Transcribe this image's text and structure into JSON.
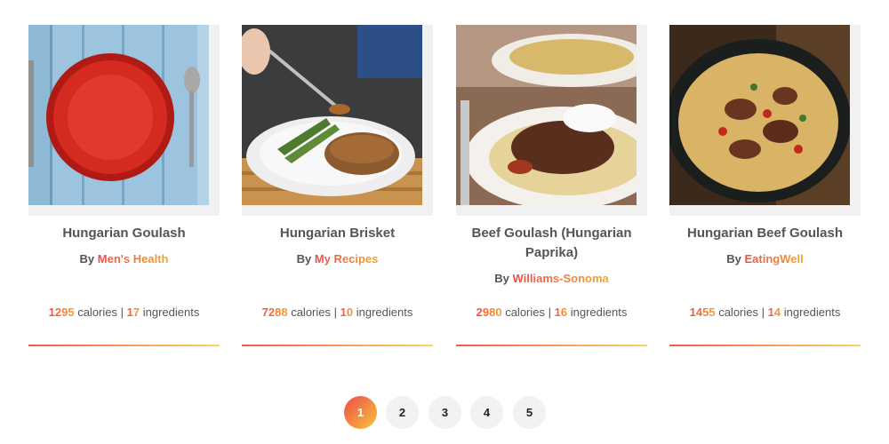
{
  "recipes": [
    {
      "title": "Hungarian Goulash",
      "by": "By",
      "source": "Men's Health",
      "calories": "1295",
      "calories_label": "calories",
      "sep": "|",
      "ingredients": "17",
      "ingredients_label": "ingredients"
    },
    {
      "title": "Hungarian Brisket",
      "by": "By",
      "source": "My Recipes",
      "calories": "7288",
      "calories_label": "calories",
      "sep": "|",
      "ingredients": "10",
      "ingredients_label": "ingredients"
    },
    {
      "title": "Beef Goulash (Hungarian Paprika)",
      "by": "By",
      "source": "Williams-Sonoma",
      "calories": "2980",
      "calories_label": "calories",
      "sep": "|",
      "ingredients": "16",
      "ingredients_label": "ingredients"
    },
    {
      "title": "Hungarian Beef Goulash",
      "by": "By",
      "source": "EatingWell",
      "calories": "1455",
      "calories_label": "calories",
      "sep": "|",
      "ingredients": "14",
      "ingredients_label": "ingredients"
    }
  ],
  "pagination": {
    "pages": [
      "1",
      "2",
      "3",
      "4",
      "5"
    ],
    "current": "1"
  },
  "colors": {
    "accent_start": "#ee4b4b",
    "accent_end": "#f4a62a",
    "text": "#555555",
    "page_bg": "#f2f2f2"
  }
}
